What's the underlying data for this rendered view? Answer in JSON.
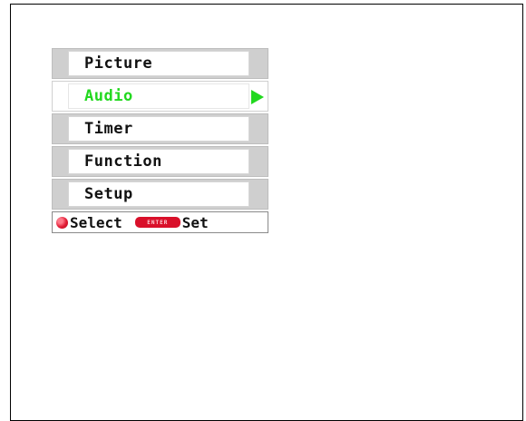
{
  "menu": {
    "items": [
      {
        "label": "Picture",
        "selected": false
      },
      {
        "label": "Audio",
        "selected": true
      },
      {
        "label": "Timer",
        "selected": false
      },
      {
        "label": "Function",
        "selected": false
      },
      {
        "label": "Setup",
        "selected": false
      }
    ]
  },
  "status": {
    "select_label": "Select",
    "enter_key_label": "ENTER",
    "set_label": "Set"
  },
  "colors": {
    "highlight": "#22d81f",
    "button_red": "#d9102a"
  },
  "icons": {
    "selector": "green-right-arrow-icon",
    "select": "red-ball-icon",
    "set": "enter-key-icon"
  }
}
